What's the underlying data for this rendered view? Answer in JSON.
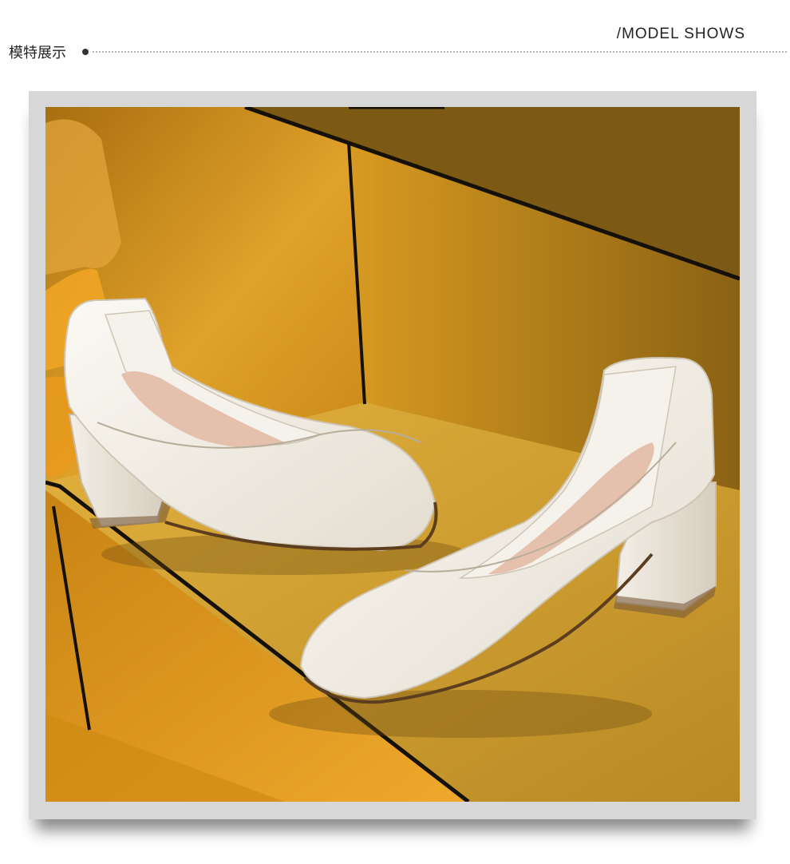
{
  "header": {
    "title_cn": "模特展示",
    "title_en": "/MODEL SHOWS"
  },
  "colors": {
    "dotted_line": "#b5b5b5",
    "frame": "#d7d7d7",
    "background_gold": "#d4961e",
    "shoe_white": "#f1ede6",
    "insole_pink": "#e4c0ad"
  },
  "photo": {
    "subject": "two white square-toe block-heel leather pumps on golden steps"
  }
}
